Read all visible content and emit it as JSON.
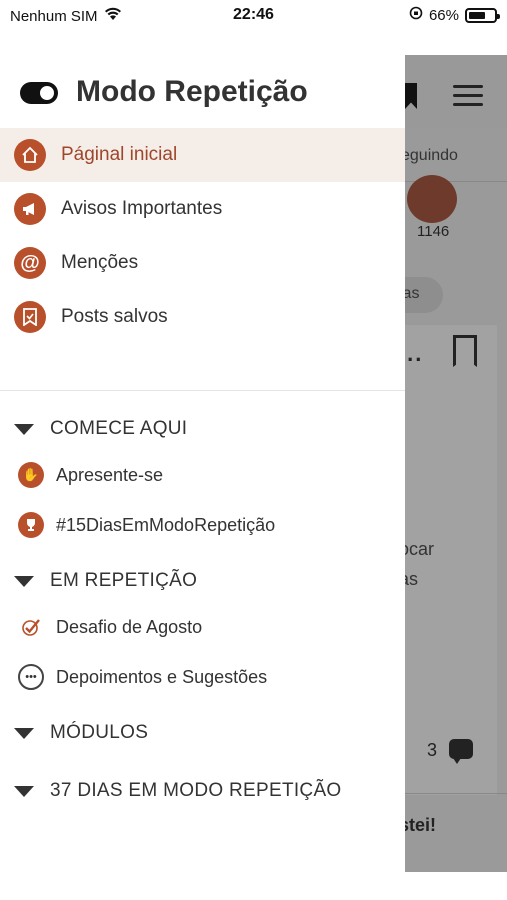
{
  "status_bar": {
    "carrier": "Nenhum SIM",
    "time": "22:46",
    "battery": "66%",
    "battery_level": 0.66
  },
  "drawer": {
    "title": "Modo Repetição",
    "nav": [
      {
        "label": "Páginal inicial",
        "icon": "home-icon",
        "active": true
      },
      {
        "label": "Avisos Importantes",
        "icon": "megaphone-icon"
      },
      {
        "label": "Menções",
        "icon": "at-icon"
      },
      {
        "label": "Posts salvos",
        "icon": "bookmark-icon"
      }
    ],
    "sections": [
      {
        "title": "COMECE AQUI",
        "items": [
          {
            "label": "Apresente-se",
            "icon": "hand-wave-icon"
          },
          {
            "label": "#15DiasEmModoRepetição",
            "icon": "trophy-icon"
          }
        ]
      },
      {
        "title": "EM REPETIÇÃO",
        "items": [
          {
            "label": "Desafio de Agosto",
            "icon": "check-icon"
          },
          {
            "label": "Depoimentos e Sugestões",
            "icon": "speech-bubble-icon"
          }
        ]
      },
      {
        "title": "MÓDULOS",
        "items": []
      },
      {
        "title": "37 DIAS EM MODO REPETIÇÃO",
        "items": []
      }
    ]
  },
  "background": {
    "tab_label": "eguindo",
    "member_count": "1146",
    "pill_label": "las",
    "card_text_1": "ocar",
    "card_text_2": "as",
    "comment_count": "3",
    "post_text": "stei!"
  },
  "colors": {
    "accent": "#b8512b",
    "active_bg": "#f5ede8"
  }
}
